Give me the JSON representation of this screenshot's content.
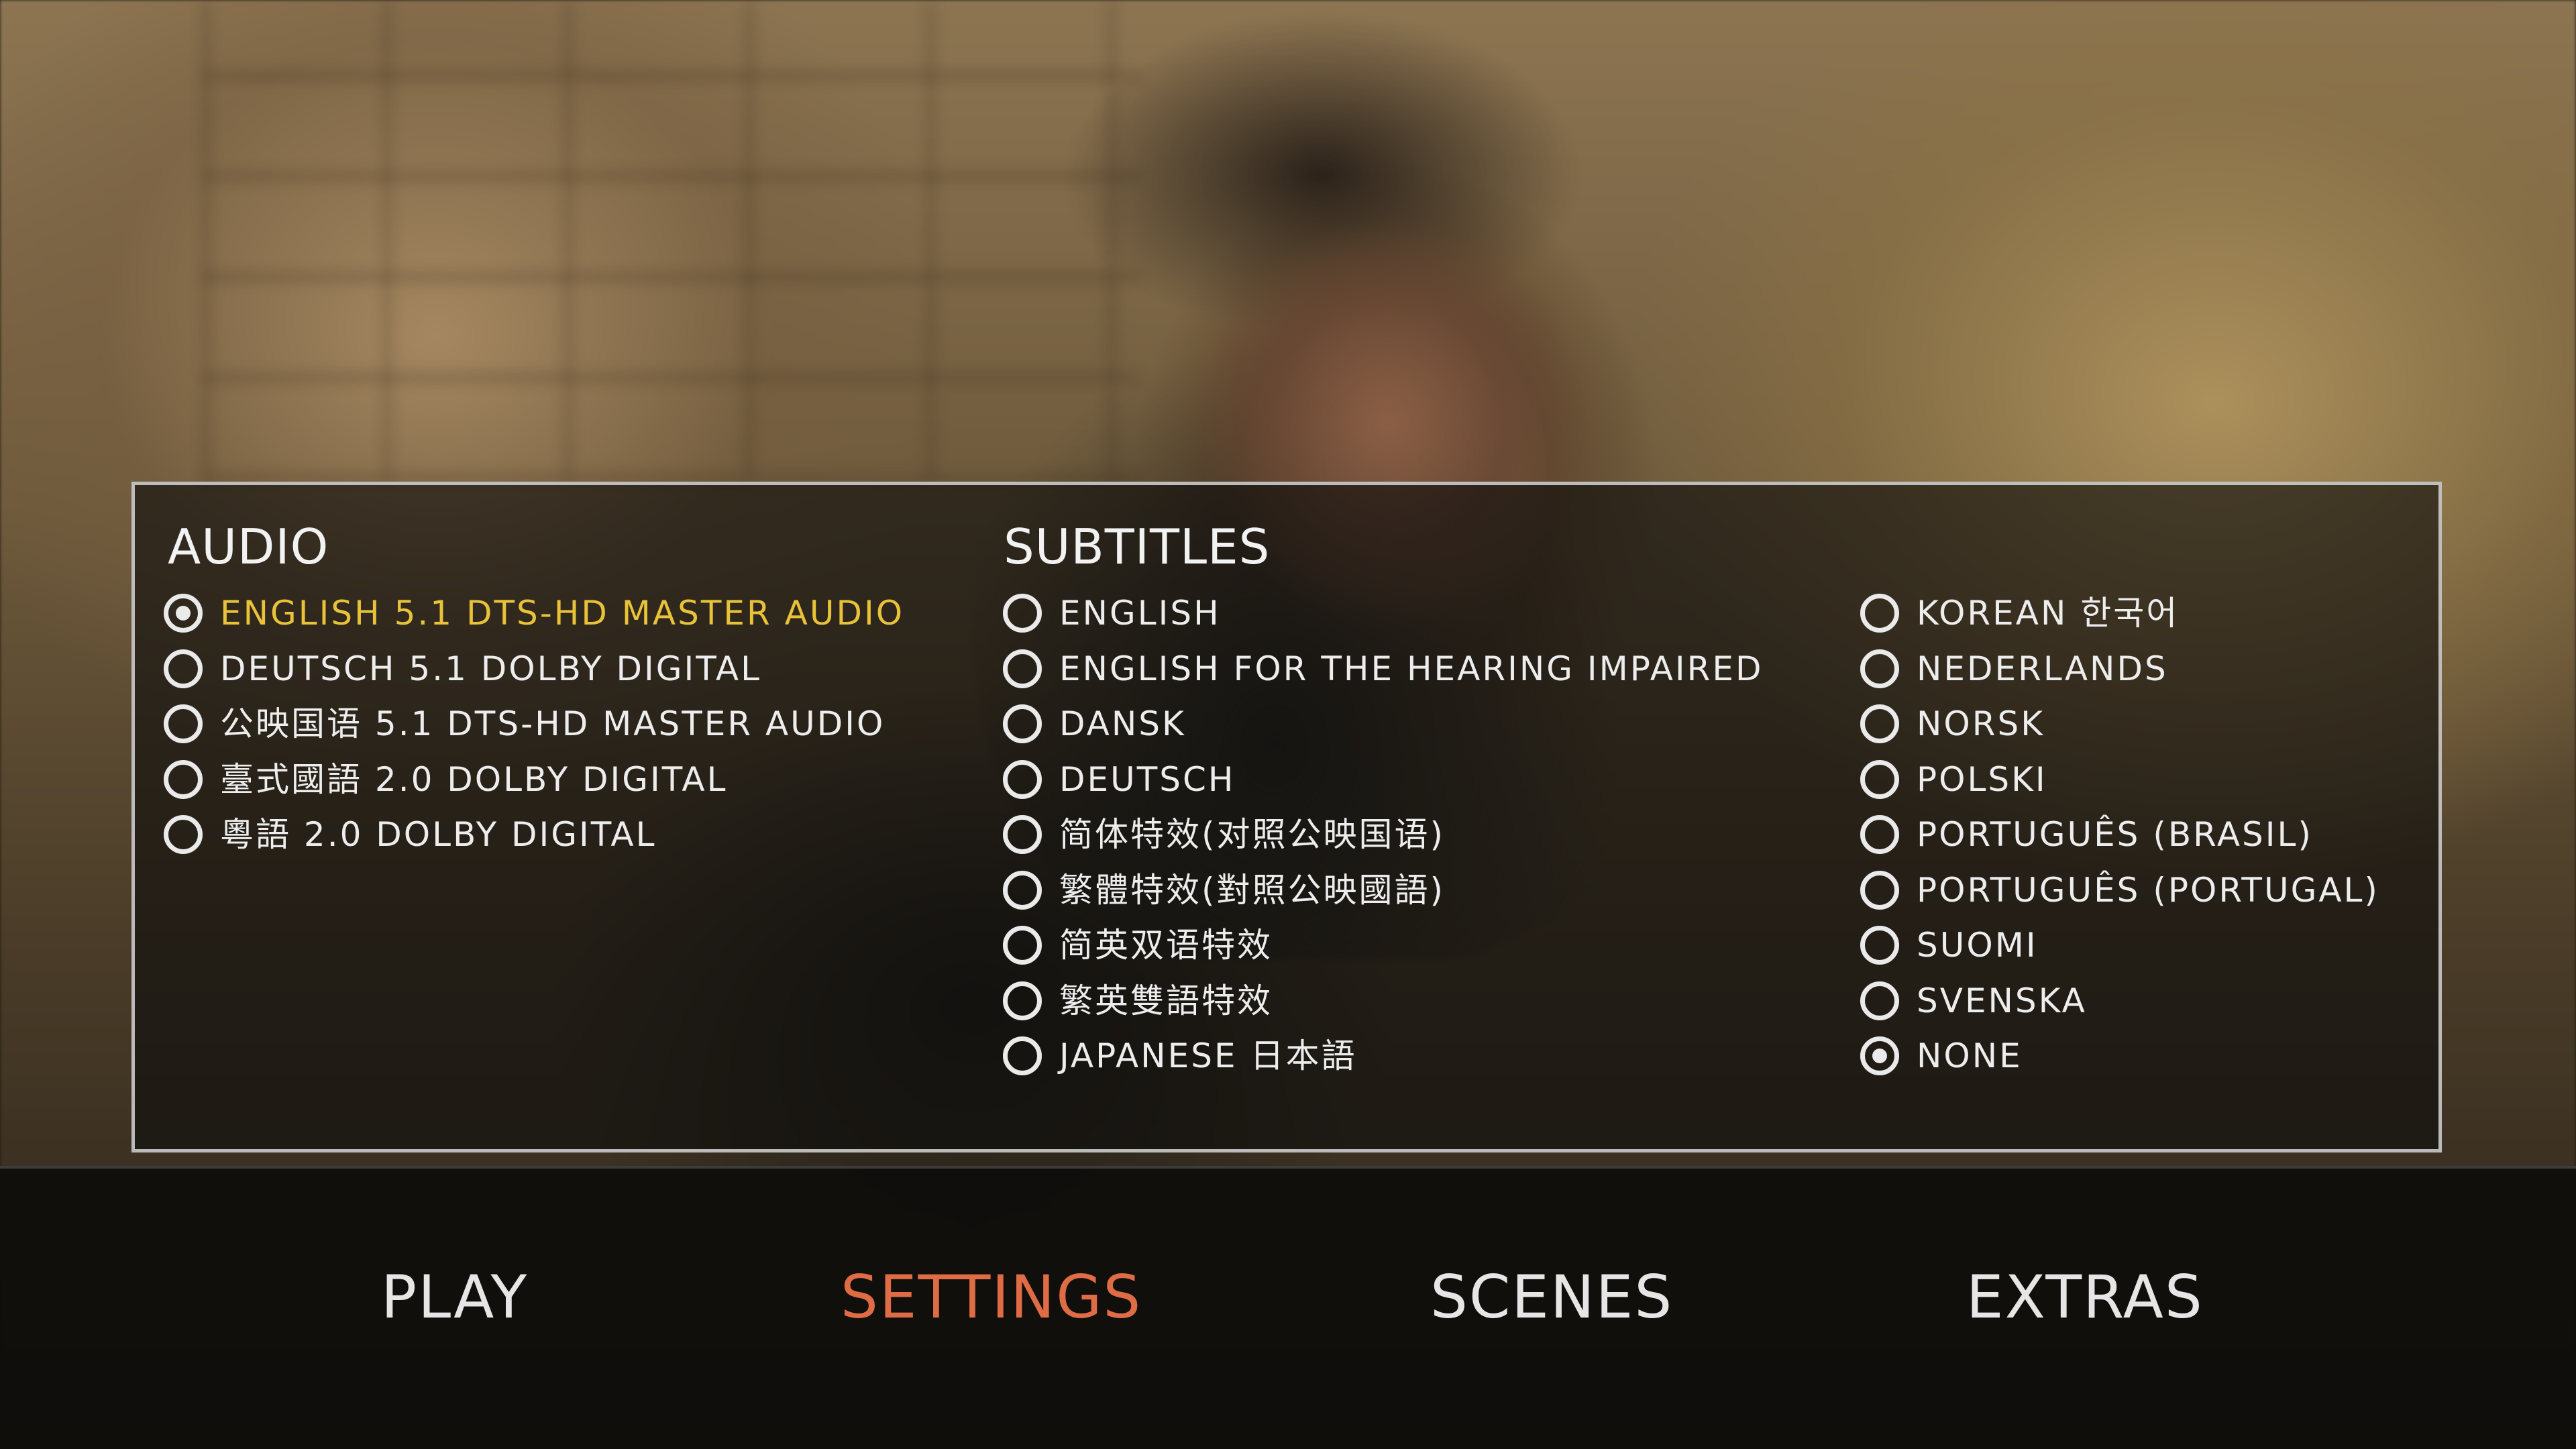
{
  "audio": {
    "title": "AUDIO",
    "options": [
      {
        "label": "ENGLISH 5.1 DTS-HD MASTER AUDIO"
      },
      {
        "label": "DEUTSCH 5.1 DOLBY DIGITAL"
      },
      {
        "label": "公映国语 5.1 DTS-HD MASTER AUDIO"
      },
      {
        "label": "臺式國語 2.0 DOLBY DIGITAL"
      },
      {
        "label": "粵語 2.0 DOLBY DIGITAL"
      }
    ],
    "selected_index": 0
  },
  "subtitles": {
    "title": "SUBTITLES",
    "column1": [
      {
        "label": "ENGLISH"
      },
      {
        "label": "ENGLISH FOR THE HEARING IMPAIRED"
      },
      {
        "label": "DANSK"
      },
      {
        "label": "DEUTSCH"
      },
      {
        "label": "简体特效(对照公映国语)"
      },
      {
        "label": "繁體特效(對照公映國語)"
      },
      {
        "label": "简英双语特效"
      },
      {
        "label": "繁英雙語特效"
      },
      {
        "label": "JAPANESE 日本語"
      }
    ],
    "column2": [
      {
        "label": "KOREAN 한국어"
      },
      {
        "label": "NEDERLANDS"
      },
      {
        "label": "NORSK"
      },
      {
        "label": "POLSKI"
      },
      {
        "label": "PORTUGUÊS (BRASIL)"
      },
      {
        "label": "PORTUGUÊS (PORTUGAL)"
      },
      {
        "label": "SUOMI"
      },
      {
        "label": "SVENSKA"
      },
      {
        "label": "NONE"
      }
    ],
    "selected": "NONE"
  },
  "nav": {
    "items": [
      {
        "label": "PLAY"
      },
      {
        "label": "SETTINGS"
      },
      {
        "label": "SCENES"
      },
      {
        "label": "EXTRAS"
      }
    ],
    "current": "SETTINGS"
  },
  "colors": {
    "highlight": "#e8c239",
    "nav_current": "#df6c45",
    "text": "#ededed"
  }
}
